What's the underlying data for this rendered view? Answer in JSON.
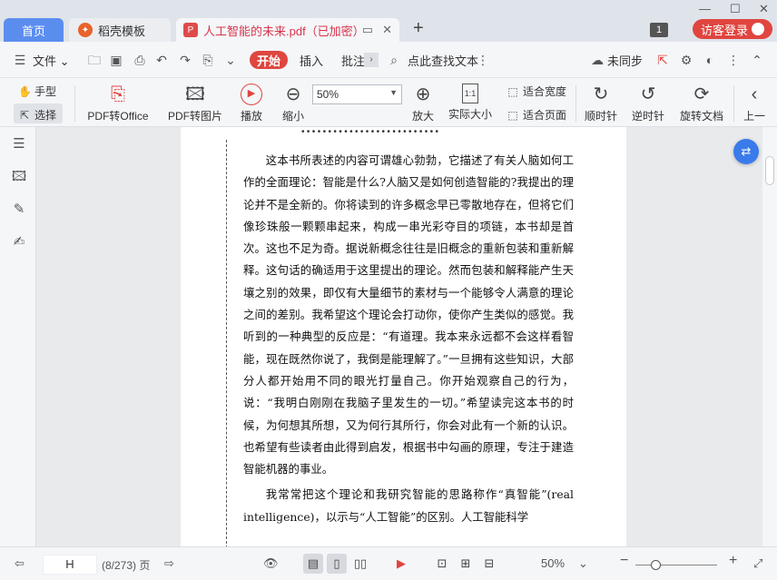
{
  "tabs": {
    "home": "首页",
    "docer": "稻壳模板",
    "pdf": "人工智能的未来.pdf（已加密）"
  },
  "titlebar": {
    "badge": "1",
    "login": "访客登录"
  },
  "menu": {
    "file": "文件",
    "start": "开始",
    "insert": "插入",
    "annotate": "批注",
    "search": "点此查找文本",
    "sync": "未同步"
  },
  "ribbon": {
    "hand": "手型",
    "select": "选择",
    "pdf_to_office": "PDF转Office",
    "pdf_to_image": "PDF转图片",
    "play": "播放",
    "zoom_out": "缩小",
    "zoom_value": "50%",
    "zoom_in": "放大",
    "actual_size": "实际大小",
    "fit_width": "适合宽度",
    "fit_page": "适合页面",
    "rotate_cw": "顺时针",
    "rotate_ccw": "逆时针",
    "rotate_doc": "旋转文档",
    "prev": "上一"
  },
  "document": {
    "dots": "••••••••••••••••••••••••••",
    "paragraphs": [
      "这本书所表述的内容可谓雄心勃勃，它描述了有关人脑如何工作的全面理论：智能是什么?人脑又是如何创造智能的?我提出的理论并不是全新的。你将读到的许多概念早已零散地存在，但将它们像珍珠般一颗颗串起来，构成一串光彩夺目的项链，本书却是首次。这也不足为奇。据说新概念往往是旧概念的重新包装和重新解释。这句话的确适用于这里提出的理论。然而包装和解释能产生天壤之别的效果，即仅有大量细节的素材与一个能够令人满意的理论之间的差别。我希望这个理论会打动你，使你产生类似的感觉。我听到的一种典型的反应是：“有道理。我本来永远都不会这样看智能，现在既然你说了，我倒是能理解了。”一旦拥有这些知识，大部分人都开始用不同的眼光打量自己。你开始观察自己的行为，说：“我明白刚刚在我脑子里发生的一切。”希望读完这本书的时候，为何想其所想，又为何行其所行，你会对此有一个新的认识。也希望有些读者由此得到启发，根据书中勾画的原理，专注于建造智能机器的事业。",
      "我常常把这个理论和我研究智能的思路称作“真智能”(real intelligence)，以示与“人工智能”的区别。人工智能科学"
    ]
  },
  "status": {
    "page_input": "H",
    "page_count": "(8/273) 页",
    "zoom": "50%"
  }
}
